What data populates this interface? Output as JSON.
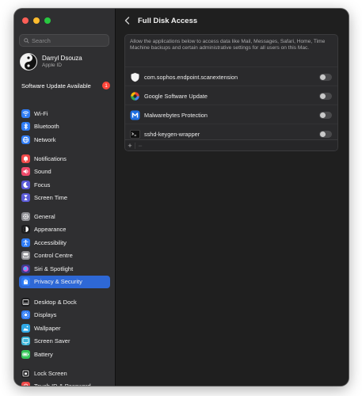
{
  "window": {
    "title": "Full Disk Access"
  },
  "search": {
    "placeholder": "Search"
  },
  "account": {
    "name": "Darryl Dsouza",
    "subtitle": "Apple ID"
  },
  "software_update": {
    "label": "Software Update Available",
    "badge": "1"
  },
  "sidebar": {
    "groups": [
      [
        {
          "label": "Wi-Fi",
          "icon": "wifi-icon",
          "color": "#2f7cf6"
        },
        {
          "label": "Bluetooth",
          "icon": "bluetooth-icon",
          "color": "#2f7cf6"
        },
        {
          "label": "Network",
          "icon": "globe-icon",
          "color": "#2f7cf6"
        }
      ],
      [
        {
          "label": "Notifications",
          "icon": "bell-icon",
          "color": "#ef4a4a"
        },
        {
          "label": "Sound",
          "icon": "speaker-icon",
          "color": "#ef4a6a"
        },
        {
          "label": "Focus",
          "icon": "moon-icon",
          "color": "#5b5bd6"
        },
        {
          "label": "Screen Time",
          "icon": "hourglass-icon",
          "color": "#5b5bd6"
        }
      ],
      [
        {
          "label": "General",
          "icon": "gear-icon",
          "color": "#8e8e93"
        },
        {
          "label": "Appearance",
          "icon": "appearance-icon",
          "color": "#1c1c1e"
        },
        {
          "label": "Accessibility",
          "icon": "accessibility-icon",
          "color": "#2f7cf6"
        },
        {
          "label": "Control Centre",
          "icon": "control-centre-icon",
          "color": "#8e8e93"
        },
        {
          "label": "Siri & Spotlight",
          "icon": "siri-icon",
          "color": "#3b3b8f"
        },
        {
          "label": "Privacy & Security",
          "icon": "hand-icon",
          "color": "#2f7cf6",
          "selected": true
        }
      ],
      [
        {
          "label": "Desktop & Dock",
          "icon": "dock-icon",
          "color": "#1c1c1e"
        },
        {
          "label": "Displays",
          "icon": "sun-icon",
          "color": "#2f7cf6"
        },
        {
          "label": "Wallpaper",
          "icon": "wallpaper-icon",
          "color": "#2fa8e6"
        },
        {
          "label": "Screen Saver",
          "icon": "screensaver-icon",
          "color": "#3fb6d9"
        },
        {
          "label": "Battery",
          "icon": "battery-icon",
          "color": "#34c759"
        }
      ],
      [
        {
          "label": "Lock Screen",
          "icon": "lock-screen-icon",
          "color": "#1c1c1e"
        },
        {
          "label": "Touch ID & Password",
          "icon": "fingerprint-icon",
          "color": "#ef4a4a"
        }
      ]
    ]
  },
  "main": {
    "description": "Allow the applications below to access data like Mail, Messages, Safari, Home, Time Machine backups and certain administrative settings for all users on this Mac.",
    "apps": [
      {
        "name": "com.sophos.endpoint.scanextension",
        "icon": "shield-icon",
        "enabled": false
      },
      {
        "name": "Google Software Update",
        "icon": "google-update-icon",
        "enabled": false
      },
      {
        "name": "Malwarebytes Protection",
        "icon": "malwarebytes-icon",
        "enabled": false
      },
      {
        "name": "sshd-keygen-wrapper",
        "icon": "terminal-icon",
        "enabled": false
      }
    ],
    "add_label": "+",
    "remove_label": "−"
  }
}
